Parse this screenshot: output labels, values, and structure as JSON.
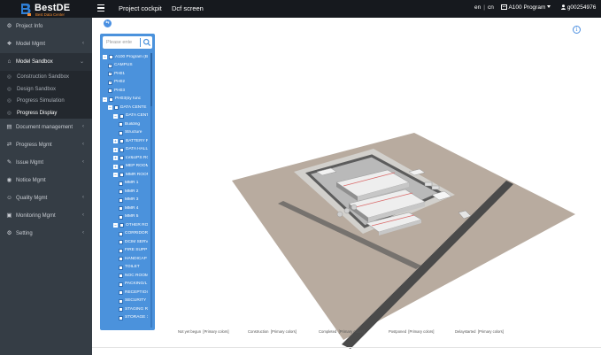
{
  "brand": {
    "name": "BestDE",
    "tagline": "Best Data Center"
  },
  "topbar": {
    "nav": [
      "Project cockpit",
      "Dcf screen"
    ],
    "lang_en": "en",
    "lang_sep": "|",
    "lang_cn": "cn",
    "program": "A100 Program",
    "user": "g00254976"
  },
  "sidebar": {
    "items": [
      {
        "label": "Project Info",
        "icon": "gear-icon",
        "chevron": ""
      },
      {
        "label": "Model Mgmt",
        "icon": "cubes-icon",
        "chevron": "‹"
      },
      {
        "label": "Model Sandbox",
        "icon": "bank-icon",
        "chevron": "⌄"
      },
      {
        "label": "Document management",
        "icon": "book-icon",
        "chevron": "‹"
      },
      {
        "label": "Progress Mgmt",
        "icon": "shuffle-icon",
        "chevron": "‹"
      },
      {
        "label": "Issue Mgmt",
        "icon": "wrench-icon",
        "chevron": "‹"
      },
      {
        "label": "Notice Mgmt",
        "icon": "bell-icon",
        "chevron": ""
      },
      {
        "label": "Quality Mgmt",
        "icon": "users-icon",
        "chevron": "‹"
      },
      {
        "label": "Monitoring Mgmt",
        "icon": "camera-icon",
        "chevron": "‹"
      },
      {
        "label": "Setting",
        "icon": "gear-icon",
        "chevron": "‹"
      }
    ],
    "subitems": [
      {
        "label": "Construction Sandbox"
      },
      {
        "label": "Design Sandbox"
      },
      {
        "label": "Progress Simulation"
      },
      {
        "label": "Progress Display"
      }
    ]
  },
  "tree": {
    "search_placeholder": "Please ente",
    "rows": [
      {
        "label": "A100 Program (BM",
        "level": 0,
        "exp": "−",
        "checked": false
      },
      {
        "label": "CAMPUS",
        "level": 1,
        "exp": "",
        "checked": true
      },
      {
        "label": "PH01",
        "level": 1,
        "exp": "",
        "checked": true
      },
      {
        "label": "PH02",
        "level": 1,
        "exp": "",
        "checked": true
      },
      {
        "label": "PH03",
        "level": 1,
        "exp": "",
        "checked": false
      },
      {
        "label": "PH03(by func",
        "level": 0,
        "exp": "−",
        "checked": false
      },
      {
        "label": "DATA CENTE",
        "level": 1,
        "exp": "−",
        "checked": false
      },
      {
        "label": "DATA CENTI",
        "level": 2,
        "exp": "−",
        "checked": false
      },
      {
        "label": "Building",
        "level": 3,
        "exp": "",
        "checked": false
      },
      {
        "label": "Structure",
        "level": 3,
        "exp": "",
        "checked": false
      },
      {
        "label": "BATTERY R(",
        "level": 2,
        "exp": "+",
        "checked": false
      },
      {
        "label": "DATA HALL",
        "level": 2,
        "exp": "+",
        "checked": false
      },
      {
        "label": "LV&UPS RO",
        "level": 2,
        "exp": "+",
        "checked": false
      },
      {
        "label": "MEP ROOM",
        "level": 2,
        "exp": "+",
        "checked": false
      },
      {
        "label": "MMR ROOM",
        "level": 2,
        "exp": "−",
        "checked": false
      },
      {
        "label": "MMR 1",
        "level": 3,
        "exp": "",
        "checked": false
      },
      {
        "label": "MMR 2",
        "level": 3,
        "exp": "",
        "checked": false
      },
      {
        "label": "MMR 3",
        "level": 3,
        "exp": "",
        "checked": false
      },
      {
        "label": "MMR 4",
        "level": 3,
        "exp": "",
        "checked": false
      },
      {
        "label": "MMR 5",
        "level": 3,
        "exp": "",
        "checked": false
      },
      {
        "label": "OTHER ROC",
        "level": 2,
        "exp": "−",
        "checked": false
      },
      {
        "label": "CORRIDOR",
        "level": 3,
        "exp": "",
        "checked": false
      },
      {
        "label": "DCIM SERV",
        "level": 3,
        "exp": "",
        "checked": false
      },
      {
        "label": "FIRE SUPP",
        "level": 3,
        "exp": "",
        "checked": false
      },
      {
        "label": "HANDICAP",
        "level": 3,
        "exp": "",
        "checked": false
      },
      {
        "label": "TOILET",
        "level": 3,
        "exp": "",
        "checked": false
      },
      {
        "label": "NOC ROOM",
        "level": 3,
        "exp": "",
        "checked": false
      },
      {
        "label": "PACKING/L",
        "level": 3,
        "exp": "",
        "checked": false
      },
      {
        "label": "RECEPTIOI",
        "level": 3,
        "exp": "",
        "checked": false
      },
      {
        "label": "SECURITY",
        "level": 3,
        "exp": "",
        "checked": false
      },
      {
        "label": "STAGING R",
        "level": 3,
        "exp": "",
        "checked": false
      },
      {
        "label": "STORAGE 1",
        "level": 3,
        "exp": "",
        "checked": false
      }
    ]
  },
  "legend": [
    {
      "label": "Not yet begun",
      "value": "[Primary colors]"
    },
    {
      "label": "Construction",
      "value": "[Primary colors]"
    },
    {
      "label": "Completed",
      "value": "[Primary colors]"
    },
    {
      "label": "Postponed",
      "value": "[Primary colors]"
    },
    {
      "label": "Delaystarted",
      "value": "[Primary colors]"
    }
  ],
  "colors": {
    "topbar": "#16191e",
    "sidebar": "#353d45",
    "tree_panel": "#4b92dc",
    "ground": "#b7ab9e",
    "road": "#444444",
    "accent": "#4a8ee0"
  }
}
